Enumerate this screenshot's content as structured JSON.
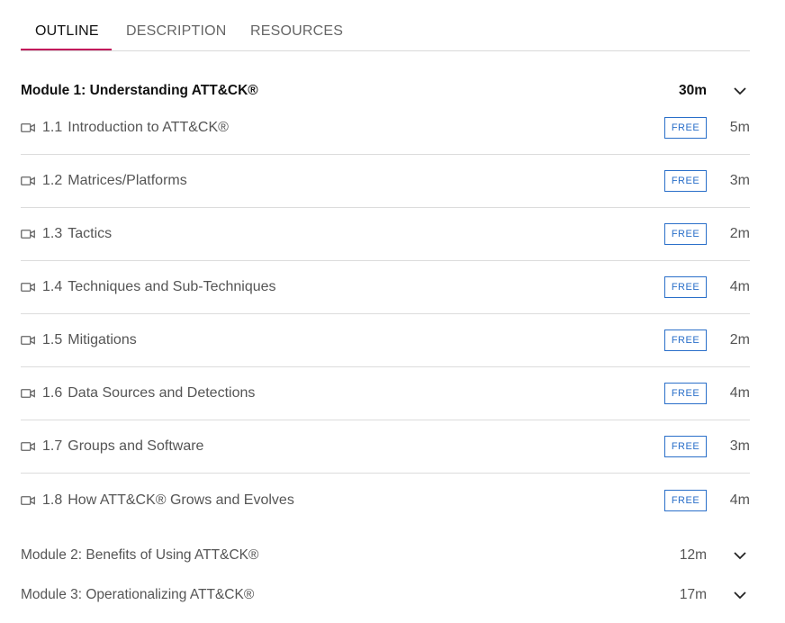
{
  "tabs": [
    {
      "label": "OUTLINE",
      "active": true
    },
    {
      "label": "DESCRIPTION",
      "active": false
    },
    {
      "label": "RESOURCES",
      "active": false
    }
  ],
  "accent_color": "#c2185b",
  "badge_color": "#2a6fc9",
  "modules": [
    {
      "title": "Module 1: Understanding ATT&CK®",
      "duration": "30m",
      "expanded": true,
      "icon": "chevron-down-icon",
      "lessons": [
        {
          "number": "1.1",
          "title": "Introduction to ATT&CK®",
          "badge": "FREE",
          "duration": "5m",
          "icon": "video-camera-icon"
        },
        {
          "number": "1.2",
          "title": "Matrices/Platforms",
          "badge": "FREE",
          "duration": "3m",
          "icon": "video-camera-icon"
        },
        {
          "number": "1.3",
          "title": "Tactics",
          "badge": "FREE",
          "duration": "2m",
          "icon": "video-camera-icon"
        },
        {
          "number": "1.4",
          "title": "Techniques and Sub-Techniques",
          "badge": "FREE",
          "duration": "4m",
          "icon": "video-camera-icon"
        },
        {
          "number": "1.5",
          "title": "Mitigations",
          "badge": "FREE",
          "duration": "2m",
          "icon": "video-camera-icon"
        },
        {
          "number": "1.6",
          "title": "Data Sources and Detections",
          "badge": "FREE",
          "duration": "4m",
          "icon": "video-camera-icon"
        },
        {
          "number": "1.7",
          "title": "Groups and Software",
          "badge": "FREE",
          "duration": "3m",
          "icon": "video-camera-icon"
        },
        {
          "number": "1.8",
          "title": "How ATT&CK® Grows and Evolves",
          "badge": "FREE",
          "duration": "4m",
          "icon": "video-camera-icon"
        }
      ]
    },
    {
      "title": "Module 2: Benefits of Using ATT&CK®",
      "duration": "12m",
      "expanded": false,
      "icon": "chevron-down-icon"
    },
    {
      "title": "Module 3: Operationalizing ATT&CK®",
      "duration": "17m",
      "expanded": false,
      "icon": "chevron-down-icon"
    }
  ]
}
